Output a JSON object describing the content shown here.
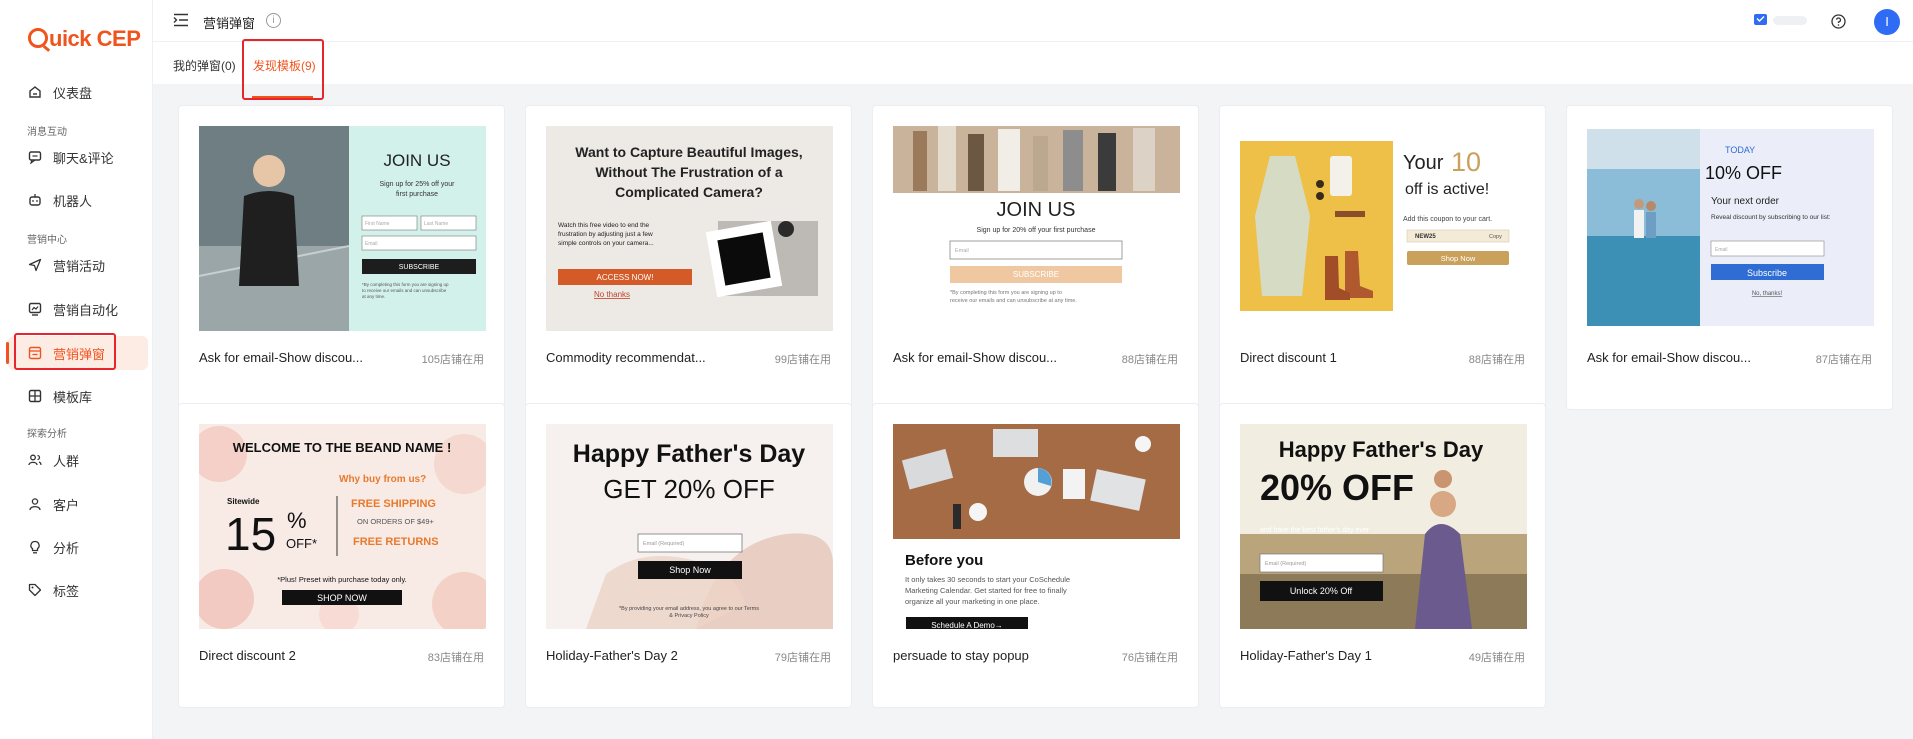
{
  "app": {
    "logo_text": "uick CEP",
    "logo_letter": "Q"
  },
  "header": {
    "page_title": "营销弹窗",
    "info_glyph": "i",
    "avatar_letter": "I"
  },
  "sidebar": {
    "items": [
      {
        "label": "仪表盘",
        "icon": "dashboard-icon"
      },
      {
        "section": "消息互动"
      },
      {
        "label": "聊天&评论",
        "icon": "chat-icon"
      },
      {
        "label": "机器人",
        "icon": "robot-icon"
      },
      {
        "section": "营销中心"
      },
      {
        "label": "营销活动",
        "icon": "send-icon"
      },
      {
        "label": "营销自动化",
        "icon": "automation-icon"
      },
      {
        "label": "营销弹窗",
        "icon": "popup-icon",
        "active": true
      },
      {
        "label": "模板库",
        "icon": "template-icon"
      },
      {
        "section": "探索分析"
      },
      {
        "label": "人群",
        "icon": "people-icon"
      },
      {
        "label": "客户",
        "icon": "user-icon"
      },
      {
        "label": "分析",
        "icon": "bulb-icon"
      },
      {
        "label": "标签",
        "icon": "tag-icon"
      }
    ]
  },
  "tabs": [
    {
      "label": "我的弹窗(0)",
      "active": false
    },
    {
      "label": "发现模板(9)",
      "active": true
    }
  ],
  "cards": [
    {
      "name": "Ask for email-Show discou...",
      "usage": "105店铺在用",
      "type": "join1"
    },
    {
      "name": "Commodity recommendat...",
      "usage": "99店铺在用",
      "type": "camera"
    },
    {
      "name": "Ask for email-Show discou...",
      "usage": "88店铺在用",
      "type": "join2"
    },
    {
      "name": "Direct discount 1",
      "usage": "88店铺在用",
      "type": "your10"
    },
    {
      "name": "Ask for email-Show discou...",
      "usage": "87店铺在用",
      "type": "today"
    },
    {
      "name": "Direct discount 2",
      "usage": "83店铺在用",
      "type": "welcome"
    },
    {
      "name": "Holiday-Father's Day 2",
      "usage": "79店铺在用",
      "type": "father2"
    },
    {
      "name": "persuade to stay popup",
      "usage": "76店铺在用",
      "type": "before"
    },
    {
      "name": "Holiday-Father's Day 1",
      "usage": "49店铺在用",
      "type": "father1"
    }
  ],
  "previews": {
    "join1": {
      "title": "JOIN US",
      "sub1": "Sign up for 25% off your",
      "sub2": "first purchase",
      "first_ph": "First Name",
      "last_ph": "Last Name",
      "email_ph": "Email",
      "button": "SUBSCRIBE",
      "fine1": "*By completing this form you are signing up",
      "fine2": "to receive our emails and can unsubscribe",
      "fine3": "at any time."
    },
    "camera": {
      "h1": "Want to Capture Beautiful Images,",
      "h2": "Without The Frustration of a",
      "h3": "Complicated Camera?",
      "b1": "Watch this free video to end the",
      "b2": "frustration by adjusting just a few",
      "b3": "simple controls on your camera...",
      "button": "ACCESS NOW!",
      "decline": "No thanks"
    },
    "join2": {
      "title": "JOIN US",
      "sub": "Sign up for 20% off your first purchase",
      "email_ph": "Email",
      "button": "SUBSCRIBE",
      "fine1": "*By completing this form you are signing up to",
      "fine2": "receive our emails and can unsubscribe at any time."
    },
    "your10": {
      "your": "Your",
      "num": "10",
      "off": "off is active!",
      "note": "Add this coupon to your cart.",
      "code": "NEW25",
      "copy": "Copy",
      "button": "Shop Now"
    },
    "today": {
      "today": "TODAY",
      "title": "10% OFF",
      "sub": "Your next order",
      "note": "Reveal discount by subscribing to our list:",
      "email_ph": "Email",
      "button": "Subscribe",
      "decline": "No, thanks!"
    },
    "welcome": {
      "title": "WELCOME TO THE BEAND NAME !",
      "why": "Why buy from us?",
      "sitewide": "Sitewide",
      "num": "15",
      "pct": "%",
      "off": "OFF*",
      "ship": "FREE SHIPPING",
      "orders": "ON ORDERS OF $49+",
      "returns": "FREE RETURNS",
      "plus": "*Plus! Preset with purchase today only.",
      "button": "SHOP NOW"
    },
    "father2": {
      "h1": "Happy Father's Day",
      "h2": "GET 20% OFF",
      "email_ph": "Email (Required)",
      "button": "Shop Now",
      "fine1": "*By providing your email address, you agree to our Terms",
      "fine2": "& Privacy Policy"
    },
    "before": {
      "title": "Before you",
      "b1": "It only takes 30 seconds to start your CoSchedule",
      "b2": "Marketing Calendar. Get started for free to finally",
      "b3": "organize all your marketing in one place.",
      "button": "Schedule A Demo→"
    },
    "father1": {
      "h1": "Happy Father's Day",
      "h2": "20% OFF",
      "sub": "and have the best father's day ever",
      "email_ph": "Email (Required)",
      "button": "Unlock 20% Off"
    }
  }
}
